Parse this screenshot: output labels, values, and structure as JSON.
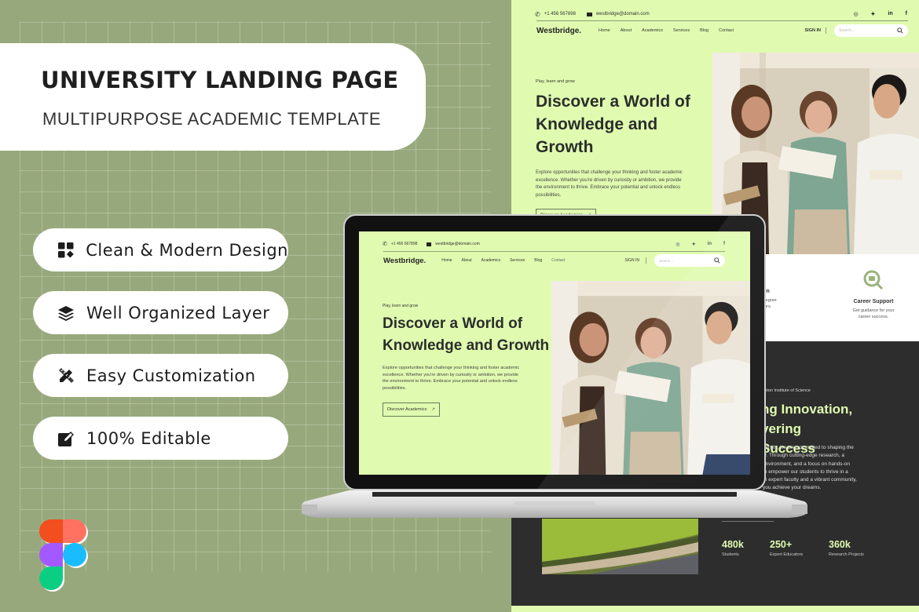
{
  "promo": {
    "title": "UNIVERSITY LANDING PAGE",
    "subtitle": "MULTIPURPOSE ACADEMIC TEMPLATE",
    "features": [
      {
        "icon": "grid-shapes-icon",
        "label": "Clean & Modern Design"
      },
      {
        "icon": "layers-icon",
        "label": "Well Organized Layer"
      },
      {
        "icon": "pencil-ruler-icon",
        "label": "Easy Customization"
      },
      {
        "icon": "edit-square-icon",
        "label": "100% Editable"
      }
    ],
    "tool_logo": "figma-logo",
    "colors": {
      "background": "#97a97c",
      "accent": "#e0fbb0",
      "dark": "#2d2d2d"
    }
  },
  "site": {
    "topbar": {
      "phone": "+1 456 567898",
      "email": "westbridge@domain.com",
      "socials": [
        "instagram-icon",
        "twitter-icon",
        "linkedin-icon",
        "facebook-icon"
      ],
      "social_glyphs": [
        "◎",
        "✦",
        "in",
        "f"
      ]
    },
    "brand": "Westbridge.",
    "nav": [
      "Home",
      "About",
      "Academics",
      "Services",
      "Blog",
      "Contact"
    ],
    "sign_in": "SIGN IN",
    "search_placeholder": "Search...",
    "hero": {
      "kicker": "Play, learn and grow",
      "title": "Discover a World of Knowledge and Growth",
      "description": "Explore opportunities that challenge your thinking and foster academic excellence. Whether you're driven by curiosity or ambition, we provide the environment to thrive. Embrace your potential and unlock endless possibilities.",
      "cta": "Discover Academics"
    },
    "features": [
      {
        "title": "tion",
        "desc_line1": "a degree",
        "desc_line2": "doors."
      },
      {
        "title": "Career Support",
        "desc_line1": "Get guidance for your",
        "desc_line2": "career success."
      }
    ],
    "about": {
      "institute": "ighton Institute of Science",
      "title_line1": "ng Innovation,",
      "title_line2": "vering Success",
      "lines": [
        "versity, we are committed to shaping the",
        "w. Through cutting-edge research, a",
        "environment, and a focus on hands-on",
        "to empower our students to thrive in a",
        "th expert faculty and a vibrant community,",
        "you achieve your dreams."
      ]
    },
    "stats": [
      {
        "value": "480k",
        "label": "Students"
      },
      {
        "value": "250+",
        "label": "Expert Educators"
      },
      {
        "value": "360k",
        "label": "Research Projects"
      }
    ]
  }
}
